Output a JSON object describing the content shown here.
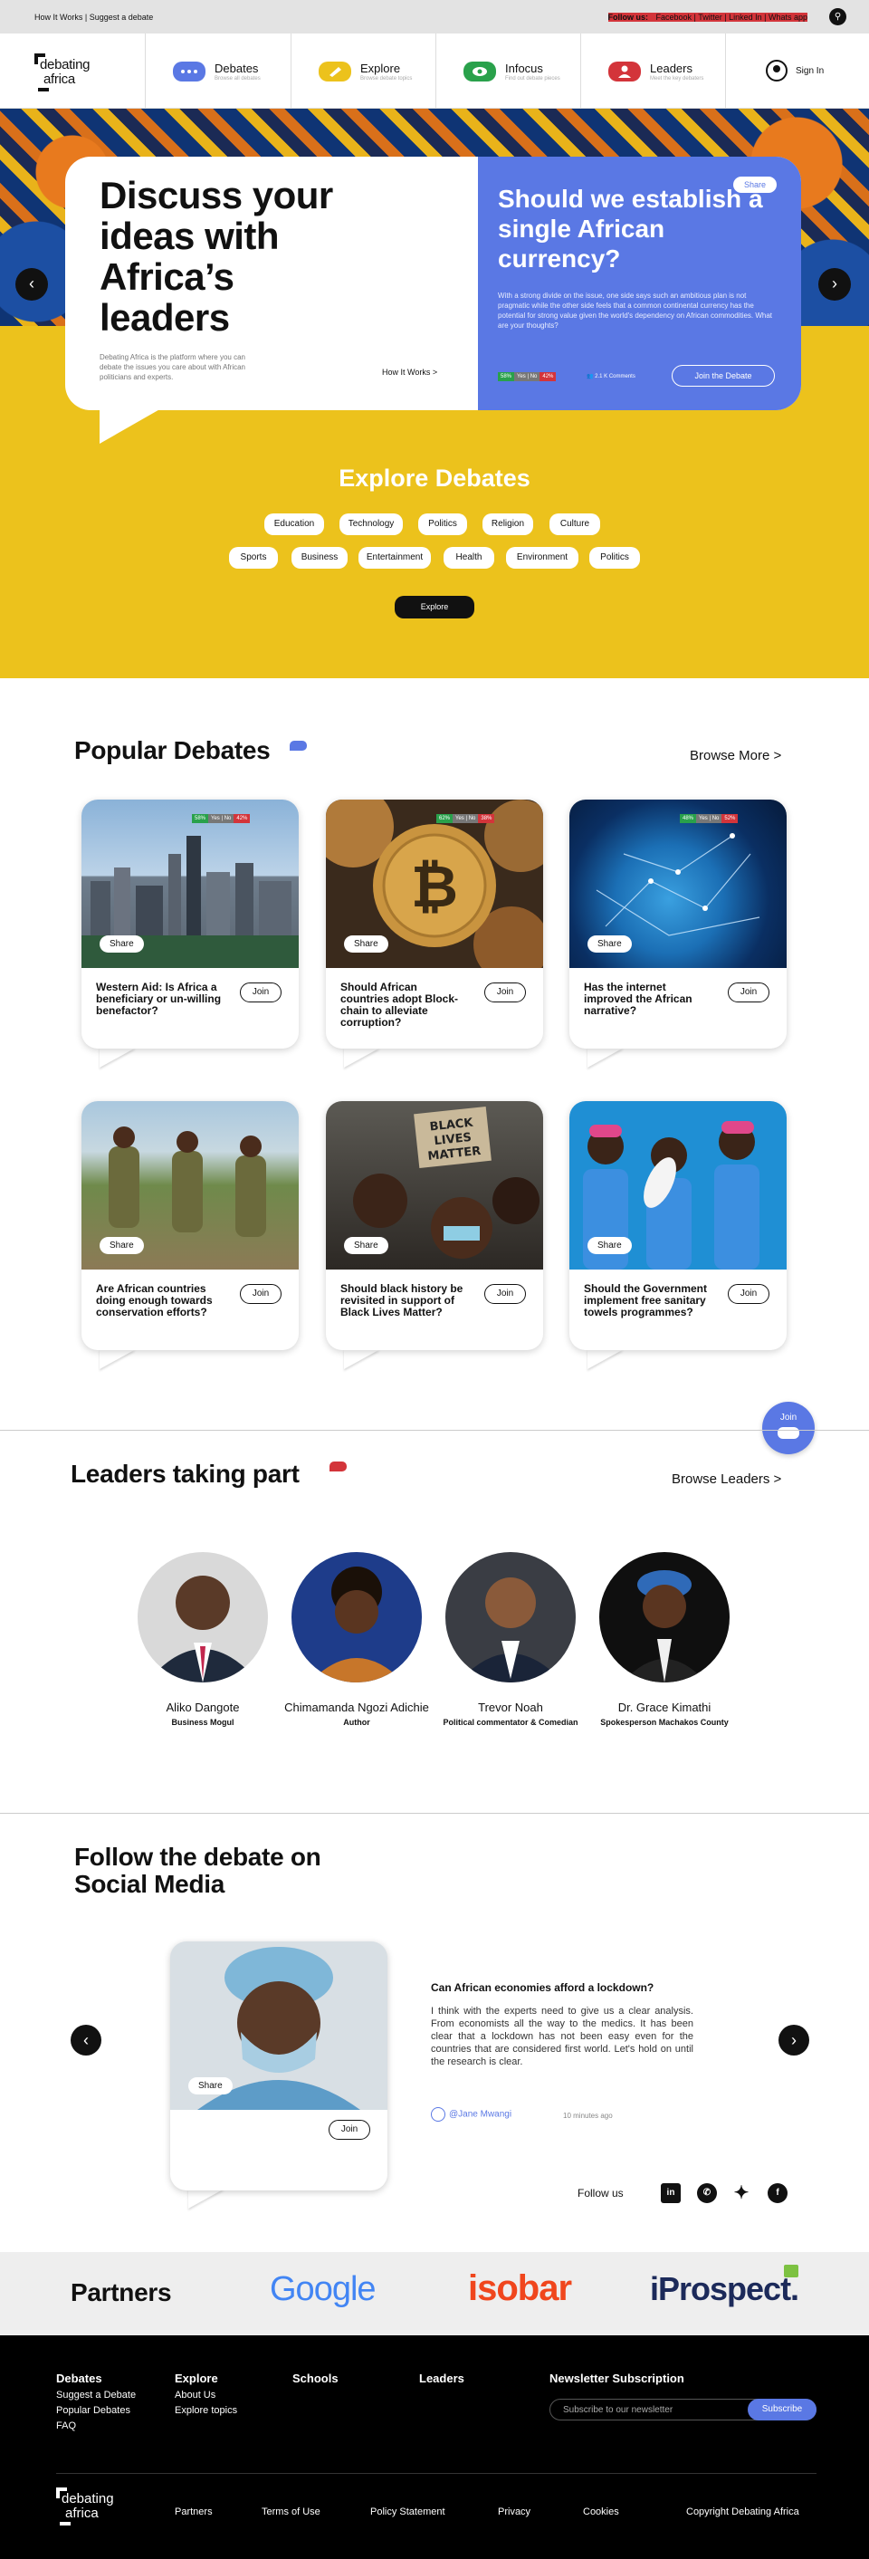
{
  "topbar": {
    "how_it_works": "How It Works",
    "suggest": "Suggest a debate",
    "follow_label": "Follow us:",
    "facebook": "Facebook",
    "twitter": "Twitter",
    "linkedin": "Linked In",
    "whatsapp": "Whats app"
  },
  "nav": {
    "logo_line1": "debating",
    "logo_line2": "africa",
    "items": [
      {
        "label": "Debates",
        "sub": "Browse all debates",
        "color": "#5a78e4"
      },
      {
        "label": "Explore",
        "sub": "Browse debate topics",
        "color": "#ecc21c"
      },
      {
        "label": "Infocus",
        "sub": "Find out debate pieces",
        "color": "#29a14b"
      },
      {
        "label": "Leaders",
        "sub": "Meet the key debaters",
        "color": "#d3343a"
      }
    ],
    "sign_in": "Sign In"
  },
  "hero": {
    "title": "Discuss your ideas with Africa’s leaders",
    "description": "Debating Africa is the platform where you can debate the issues you care about with African politicians and experts.",
    "how_it_works": "How It Works >",
    "question": "Should we establish a single African currency?",
    "question_desc": "With a strong divide on the issue, one side says such an ambitious plan is not pragmatic while the other side feels that a common continental currency has the potential for strong value given the world's dependency on African commodities. What are your thoughts?",
    "share": "Share",
    "yes": "58%",
    "mid": "Yes | No",
    "no": "42%",
    "comments": "2.1 K Comments",
    "join": "Join the Debate"
  },
  "explore": {
    "title": "Explore Debates",
    "row1": [
      "Education",
      "Technology",
      "Politics",
      "Religion",
      "Culture"
    ],
    "row2": [
      "Sports",
      "Business",
      "Entertainment",
      "Health",
      "Environment",
      "Politics"
    ],
    "button": "Explore"
  },
  "popular": {
    "title": "Popular Debates",
    "browse": "Browse More >",
    "share": "Share",
    "join": "Join",
    "meter_mid": "Yes | No",
    "cards": [
      {
        "title": "Western Aid: Is Africa a beneficiary or un-willing benefactor?",
        "yes": "58%",
        "no": "42%"
      },
      {
        "title": "Should African countries adopt Block-chain to alleviate corruption?",
        "yes": "62%",
        "no": "38%"
      },
      {
        "title": "Has the internet improved the African narrative?",
        "yes": "48%",
        "no": "52%"
      },
      {
        "title": "Are African countries doing enough towards conservation efforts?"
      },
      {
        "title": "Should black history be revisited in support of Black Lives Matter?",
        "sign1": "BLACK",
        "sign2": "LIVES",
        "sign3": "MATTER"
      },
      {
        "title": "Should the Government implement free sanitary towels programmes?"
      }
    ]
  },
  "float_join": "Join",
  "leaders": {
    "title": "Leaders taking part",
    "browse": "Browse Leaders >",
    "people": [
      {
        "name": "Aliko Dangote",
        "role": "Business Mogul"
      },
      {
        "name": "Chimamanda Ngozi Adichie",
        "role": "Author"
      },
      {
        "name": "Trevor Noah",
        "role": "Political commentator & Comedian"
      },
      {
        "name": "Dr. Grace  Kimathi",
        "role": "Spokesperson Machakos County"
      }
    ]
  },
  "social": {
    "title": "Follow the debate on Social Media",
    "share": "Share",
    "join": "Join",
    "quote_title": "Can African economies afford a lockdown?",
    "quote_body": "I think with the experts need to give us a clear analysis. From economists all the way to the medics. It has been clear that a lockdown has not been easy even for the countries that are considered first world. Let's hold on until the research is clear.",
    "user": "@Jane Mwangi",
    "time": "10 minutes ago",
    "follow_us": "Follow us"
  },
  "partners": {
    "title": "Partners",
    "google": "Google",
    "isobar": "isobar",
    "iprospect": "iProspect."
  },
  "footer": {
    "debates": "Debates",
    "debates_links": [
      "Suggest a Debate",
      "Popular Debates",
      "FAQ"
    ],
    "explore": "Explore",
    "explore_links": [
      "About Us",
      "Explore topics"
    ],
    "schools": "Schools",
    "leaders": "Leaders",
    "newsletter": "Newsletter Subscription",
    "newsletter_placeholder": "Subscribe to our newsletter",
    "subscribe": "Subscribe",
    "logo_line1": "debating",
    "logo_line2": "africa",
    "bottom_links": [
      "Partners",
      "Terms of Use",
      "Policy Statement",
      "Privacy",
      "Cookies"
    ],
    "copyright": "Copyright Debating Africa"
  }
}
